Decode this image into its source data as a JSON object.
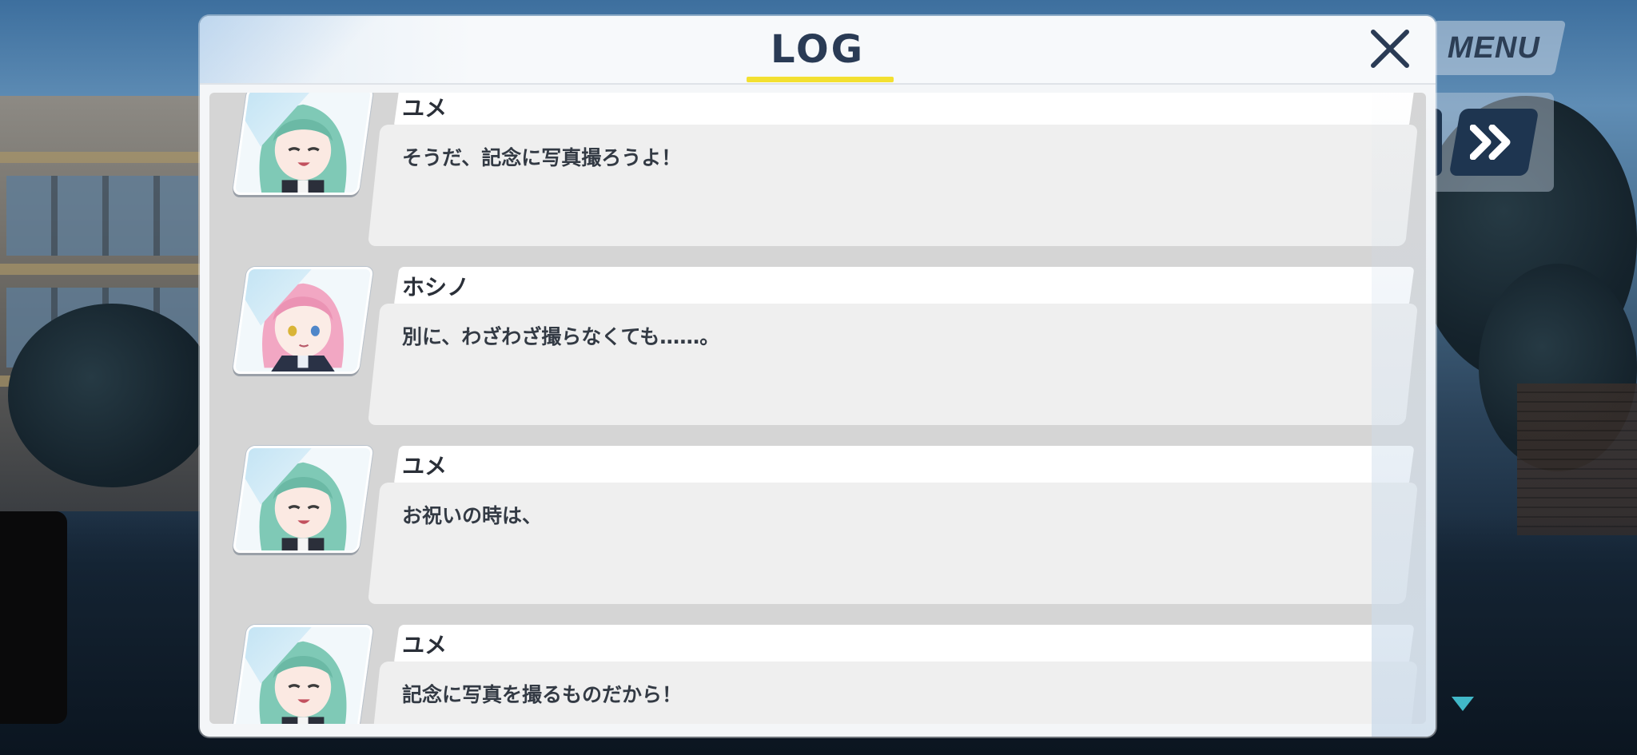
{
  "hud": {
    "menu_label": "MENU",
    "fast_forward_icon": "fast-forward-icon"
  },
  "log": {
    "title": "LOG",
    "close_icon": "close-icon",
    "accent_color": "#f3e030",
    "entries": [
      {
        "speaker": "ユメ",
        "text": "そうだ、記念に写真撮ろうよ！",
        "character": "yume"
      },
      {
        "speaker": "ホシノ",
        "text": "別に、わざわざ撮らなくても……。",
        "character": "hoshino"
      },
      {
        "speaker": "ユメ",
        "text": "お祝いの時は、",
        "character": "yume"
      },
      {
        "speaker": "ユメ",
        "text": "記念に写真を撮るものだから！",
        "character": "yume"
      }
    ]
  },
  "colors": {
    "yume_hair": "#7fc9b6",
    "hoshino_hair": "#f2a7c3",
    "title_text": "#2a3b55"
  }
}
